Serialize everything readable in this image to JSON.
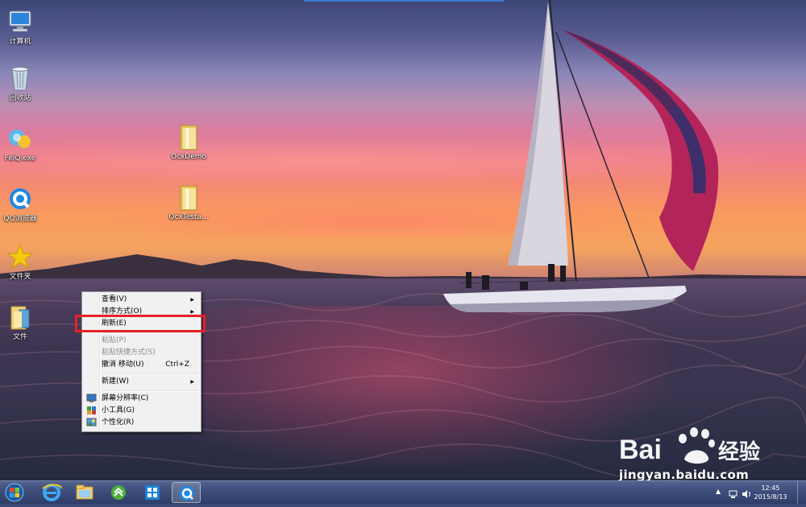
{
  "desktop_icons": [
    {
      "label": "计算机",
      "icon": "computer-icon"
    },
    {
      "label": "回收站",
      "icon": "recycle-bin-icon"
    },
    {
      "label": "FeiQ.exe",
      "icon": "feiq-icon"
    },
    {
      "label": "QQ浏览器",
      "icon": "qq-browser-icon"
    },
    {
      "label": "文件夹",
      "icon": "star-folder-icon"
    },
    {
      "label": "文件",
      "icon": "file-folder-icon"
    },
    {
      "label": "OcxDemo",
      "icon": "folder-icon"
    },
    {
      "label": "OcxTesta...",
      "icon": "folder-icon"
    }
  ],
  "context_menu": {
    "items": {
      "view": {
        "label": "查看(V)",
        "submenu": true
      },
      "sort": {
        "label": "排序方式(O)",
        "submenu": true
      },
      "refresh": {
        "label": "刷新(E)"
      },
      "paste": {
        "label": "粘贴(P)",
        "disabled": true
      },
      "paste_shortcut": {
        "label": "粘贴快捷方式(S)",
        "disabled": true
      },
      "undo": {
        "label": "撤消 移动(U)",
        "accelerator": "Ctrl+Z"
      },
      "new": {
        "label": "新建(W)",
        "submenu": true
      },
      "screen_resolution": {
        "label": "屏幕分辨率(C)",
        "icon": "display-icon"
      },
      "gadgets": {
        "label": "小工具(G)",
        "icon": "gadgets-icon"
      },
      "personalize": {
        "label": "个性化(R)",
        "icon": "personalize-icon"
      }
    },
    "highlighted_item": "refresh",
    "highlight_color": "#e8202a"
  },
  "taskbar": {
    "pinned": [
      {
        "name": "start-orb-icon"
      },
      {
        "name": "internet-explorer-icon"
      },
      {
        "name": "file-explorer-icon"
      },
      {
        "name": "green-app-icon"
      },
      {
        "name": "blue-app-icon"
      },
      {
        "name": "qq-browser-icon",
        "active": true
      }
    ],
    "clock": {
      "time": "12:45",
      "date": "2015/8/13"
    },
    "tray_icons": [
      "show-hidden-icons-arrow",
      "network-icon",
      "volume-icon"
    ]
  },
  "watermark": {
    "brand": "Bai",
    "brand2": "经验",
    "url": "jingyan.baidu.com"
  },
  "colors": {
    "taskbar": "#3f4f7c",
    "menu_bg": "#f1f1f1",
    "accent_blue": "#3a7bd5"
  }
}
